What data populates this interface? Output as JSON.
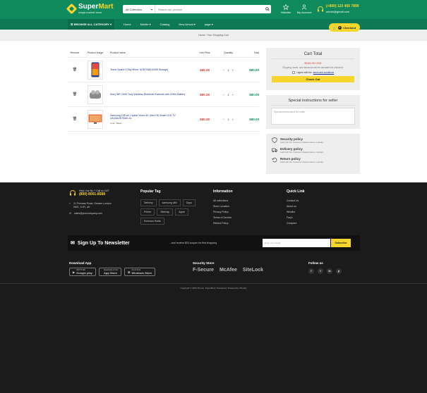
{
  "header": {
    "logo_name_1": "Super",
    "logo_name_2": "Mart",
    "logo_tagline": "mega market store",
    "search_category": "All Collection",
    "search_placeholder": "Search our product",
    "wishlist_label": "Wishlist",
    "account_label": "My Account",
    "phone": "(+800) 123 456 7890",
    "email": "admin@gmail.com"
  },
  "nav": {
    "browse_label": "BROWSE ALL CATEGORY",
    "items": [
      "Home",
      "Mobile",
      "Catalog",
      "New Arrival",
      "page"
    ],
    "checkout_label": "Checkout",
    "cart_count": "3"
  },
  "breadcrumb": {
    "home": "Home",
    "sep": "/",
    "current": "Your Shopping Cart"
  },
  "cart_table": {
    "headers": [
      "Remove",
      "Product image",
      "Product name",
      "Unit Price",
      "Quantity",
      "Total"
    ],
    "rows": [
      {
        "name": "Tecno Spark 9 (Sky Mirror, 6GB RAM,64GB Storage)",
        "color": "",
        "unit_price": "$80.28",
        "qty": "1",
        "total": "$80.00"
      },
      {
        "name": "Sony WF-C500 Truly Wireless Bluetooth Earbuds with 20Hrs Battery",
        "color": "",
        "unit_price": "$80.28",
        "qty": "1",
        "total": "$80.00"
      },
      {
        "name": "Samsung 108 cm Crystal Vision 4K Ultra HD Smart LED TV UA43AUE70AKLXL",
        "color": "Color: Black",
        "unit_price": "$80.28",
        "qty": "1",
        "total": "$80.00"
      }
    ]
  },
  "cart_total": {
    "title": "Cart Total",
    "amount": "$240.00 USD",
    "note": "Shipping, taxes, and discounts will be calculated at checkout.",
    "agree_text": "I agree with the",
    "agree_link": "terms and conditions",
    "checkout_btn": "Check Out"
  },
  "instructions": {
    "title": "Special instructions for seller",
    "placeholder": "Special instructions for seller"
  },
  "policies": [
    {
      "title": "Security policy",
      "desc": "(edit with the Customer Reassurance module)"
    },
    {
      "title": "Delivery policy",
      "desc": "(edit with the Customer Reassurance module)"
    },
    {
      "title": "Return policy",
      "desc": "(edit with the Customer Reassurance module)"
    }
  ],
  "footer": {
    "help_line": "Help Line No ? Call us 24/7",
    "help_phone": "(800) 8001-8588",
    "address_1": "11 Princess Road, Greater London",
    "address_2": "NW1, 8 JR, UK",
    "email": "sales@yourcompany.com",
    "popular_tag_title": "Popular Tag",
    "tags": [
      "Delivery",
      "samsung a50",
      "Oppo",
      "Printer",
      "Sitemap",
      "Apple",
      "Emerson Radio"
    ],
    "info_title": "Information",
    "info_links": [
      "All collections",
      "Store Location",
      "Privacy Policy",
      "Terms of Service",
      "Refund Policy"
    ],
    "quick_title": "Quick Link",
    "quick_links": [
      "Contact Us",
      "About us",
      "Wishlist",
      "Faq's",
      "Compare"
    ],
    "newsletter_title": "Sign Up To Newsletter",
    "newsletter_sub": "...and receive $20 coupon for first shopping",
    "newsletter_placeholder": "Enter Your Email",
    "newsletter_btn": "Subscribe",
    "download_title": "Download App",
    "google_small": "GET IT ON",
    "google_label": "Google play",
    "apple_small": "Download on the",
    "apple_label": "App Store",
    "windows_small": "Get it from",
    "windows_label": "Windows Store",
    "security_title": "Security Store",
    "security_brands": [
      "F-Secure",
      "McAfee",
      "SiteLock"
    ],
    "follow_title": "Follow us",
    "social": [
      "f",
      "t",
      "in",
      "p"
    ],
    "copyright": "Copyright © 2024 Theme. SuperMart | Password | Powered by Shopify"
  }
}
